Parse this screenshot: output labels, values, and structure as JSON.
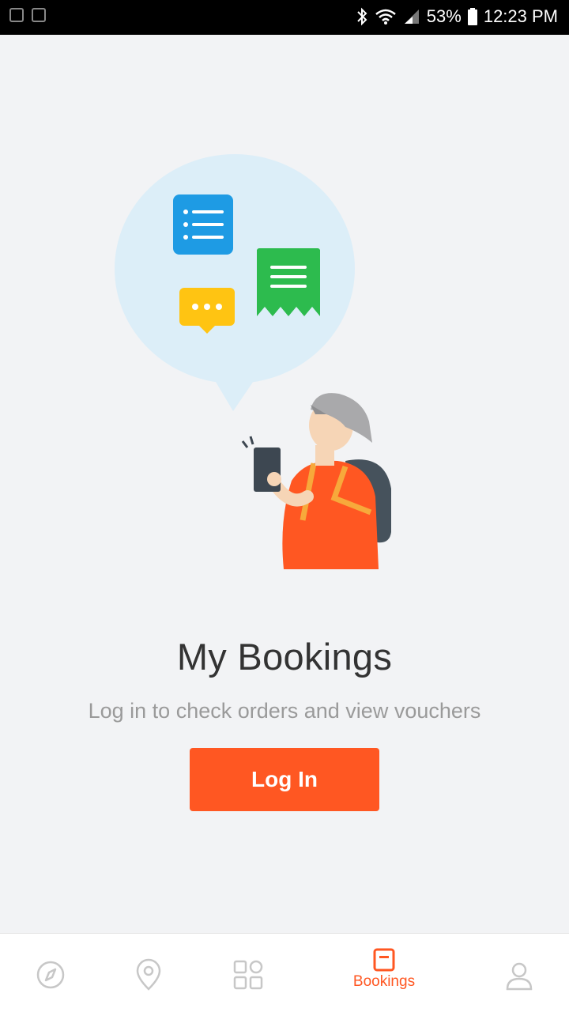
{
  "status_bar": {
    "battery": "53%",
    "time": "12:23 PM"
  },
  "main": {
    "title": "My Bookings",
    "subtitle": "Log in to check orders and view vouchers",
    "login_button": "Log In"
  },
  "bottom_nav": {
    "items": [
      {
        "icon": "compass-icon",
        "label": ""
      },
      {
        "icon": "location-pin-icon",
        "label": ""
      },
      {
        "icon": "grid-icon",
        "label": ""
      },
      {
        "icon": "bookings-icon",
        "label": "Bookings",
        "active": true
      },
      {
        "icon": "profile-icon",
        "label": ""
      }
    ]
  },
  "colors": {
    "accent": "#ff5722",
    "title_text": "#333333",
    "subtitle_text": "#9a9a9a",
    "background": "#f2f3f5"
  }
}
